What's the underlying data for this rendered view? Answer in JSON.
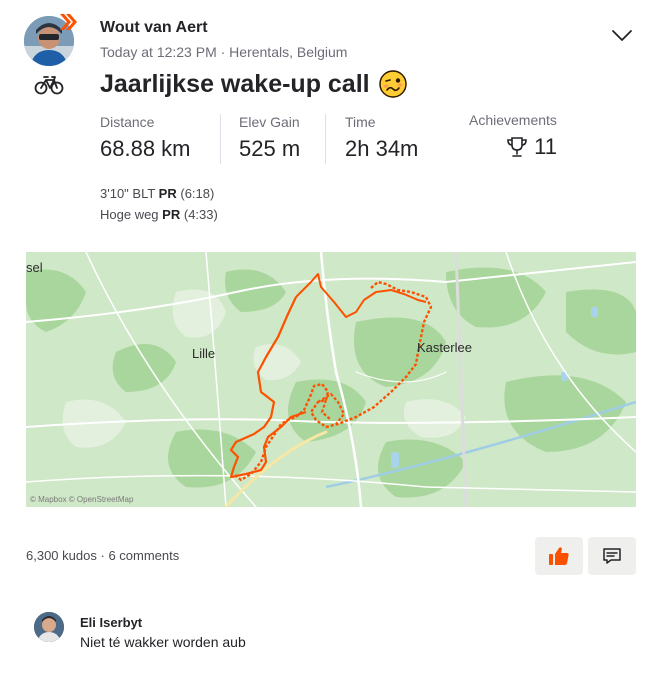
{
  "athlete": {
    "name": "Wout van Aert"
  },
  "activity": {
    "meta": "Today at 12:23 PM · Herentals, Belgium",
    "title": "Jaarlijkse wake-up call",
    "sport_icon": "bike-icon",
    "title_emoji": "woozy-face-emoji"
  },
  "stats": {
    "distance_label": "Distance",
    "distance_value": "68.88 km",
    "elev_label": "Elev Gain",
    "elev_value": "525 m",
    "time_label": "Time",
    "time_value": "2h 34m",
    "achievements_label": "Achievements",
    "achievements_value": "11"
  },
  "segments": [
    {
      "name": "3'10\" BLT",
      "badge": "PR",
      "time": "(6:18)"
    },
    {
      "name": "Hoge weg",
      "badge": "PR",
      "time": "(4:33)"
    }
  ],
  "map": {
    "labels": {
      "left_edge": "sel",
      "lille": "Lille",
      "kasterlee": "Kasterlee"
    },
    "credit": "© Mapbox © OpenStreetMap",
    "route_color": "#fc5200"
  },
  "social": {
    "kudos_text": "6,300 kudos",
    "separator": "·",
    "comments_text": "6 comments",
    "kudos_button_icon": "thumbs-up-icon",
    "comment_button_icon": "comment-icon"
  },
  "comment": {
    "author": "Eli Iserbyt",
    "text": "Niet té wakker worden aub"
  },
  "colors": {
    "accent": "#fc5200",
    "text": "#242428",
    "muted": "#6d6d78",
    "button_bg": "#efefee"
  }
}
